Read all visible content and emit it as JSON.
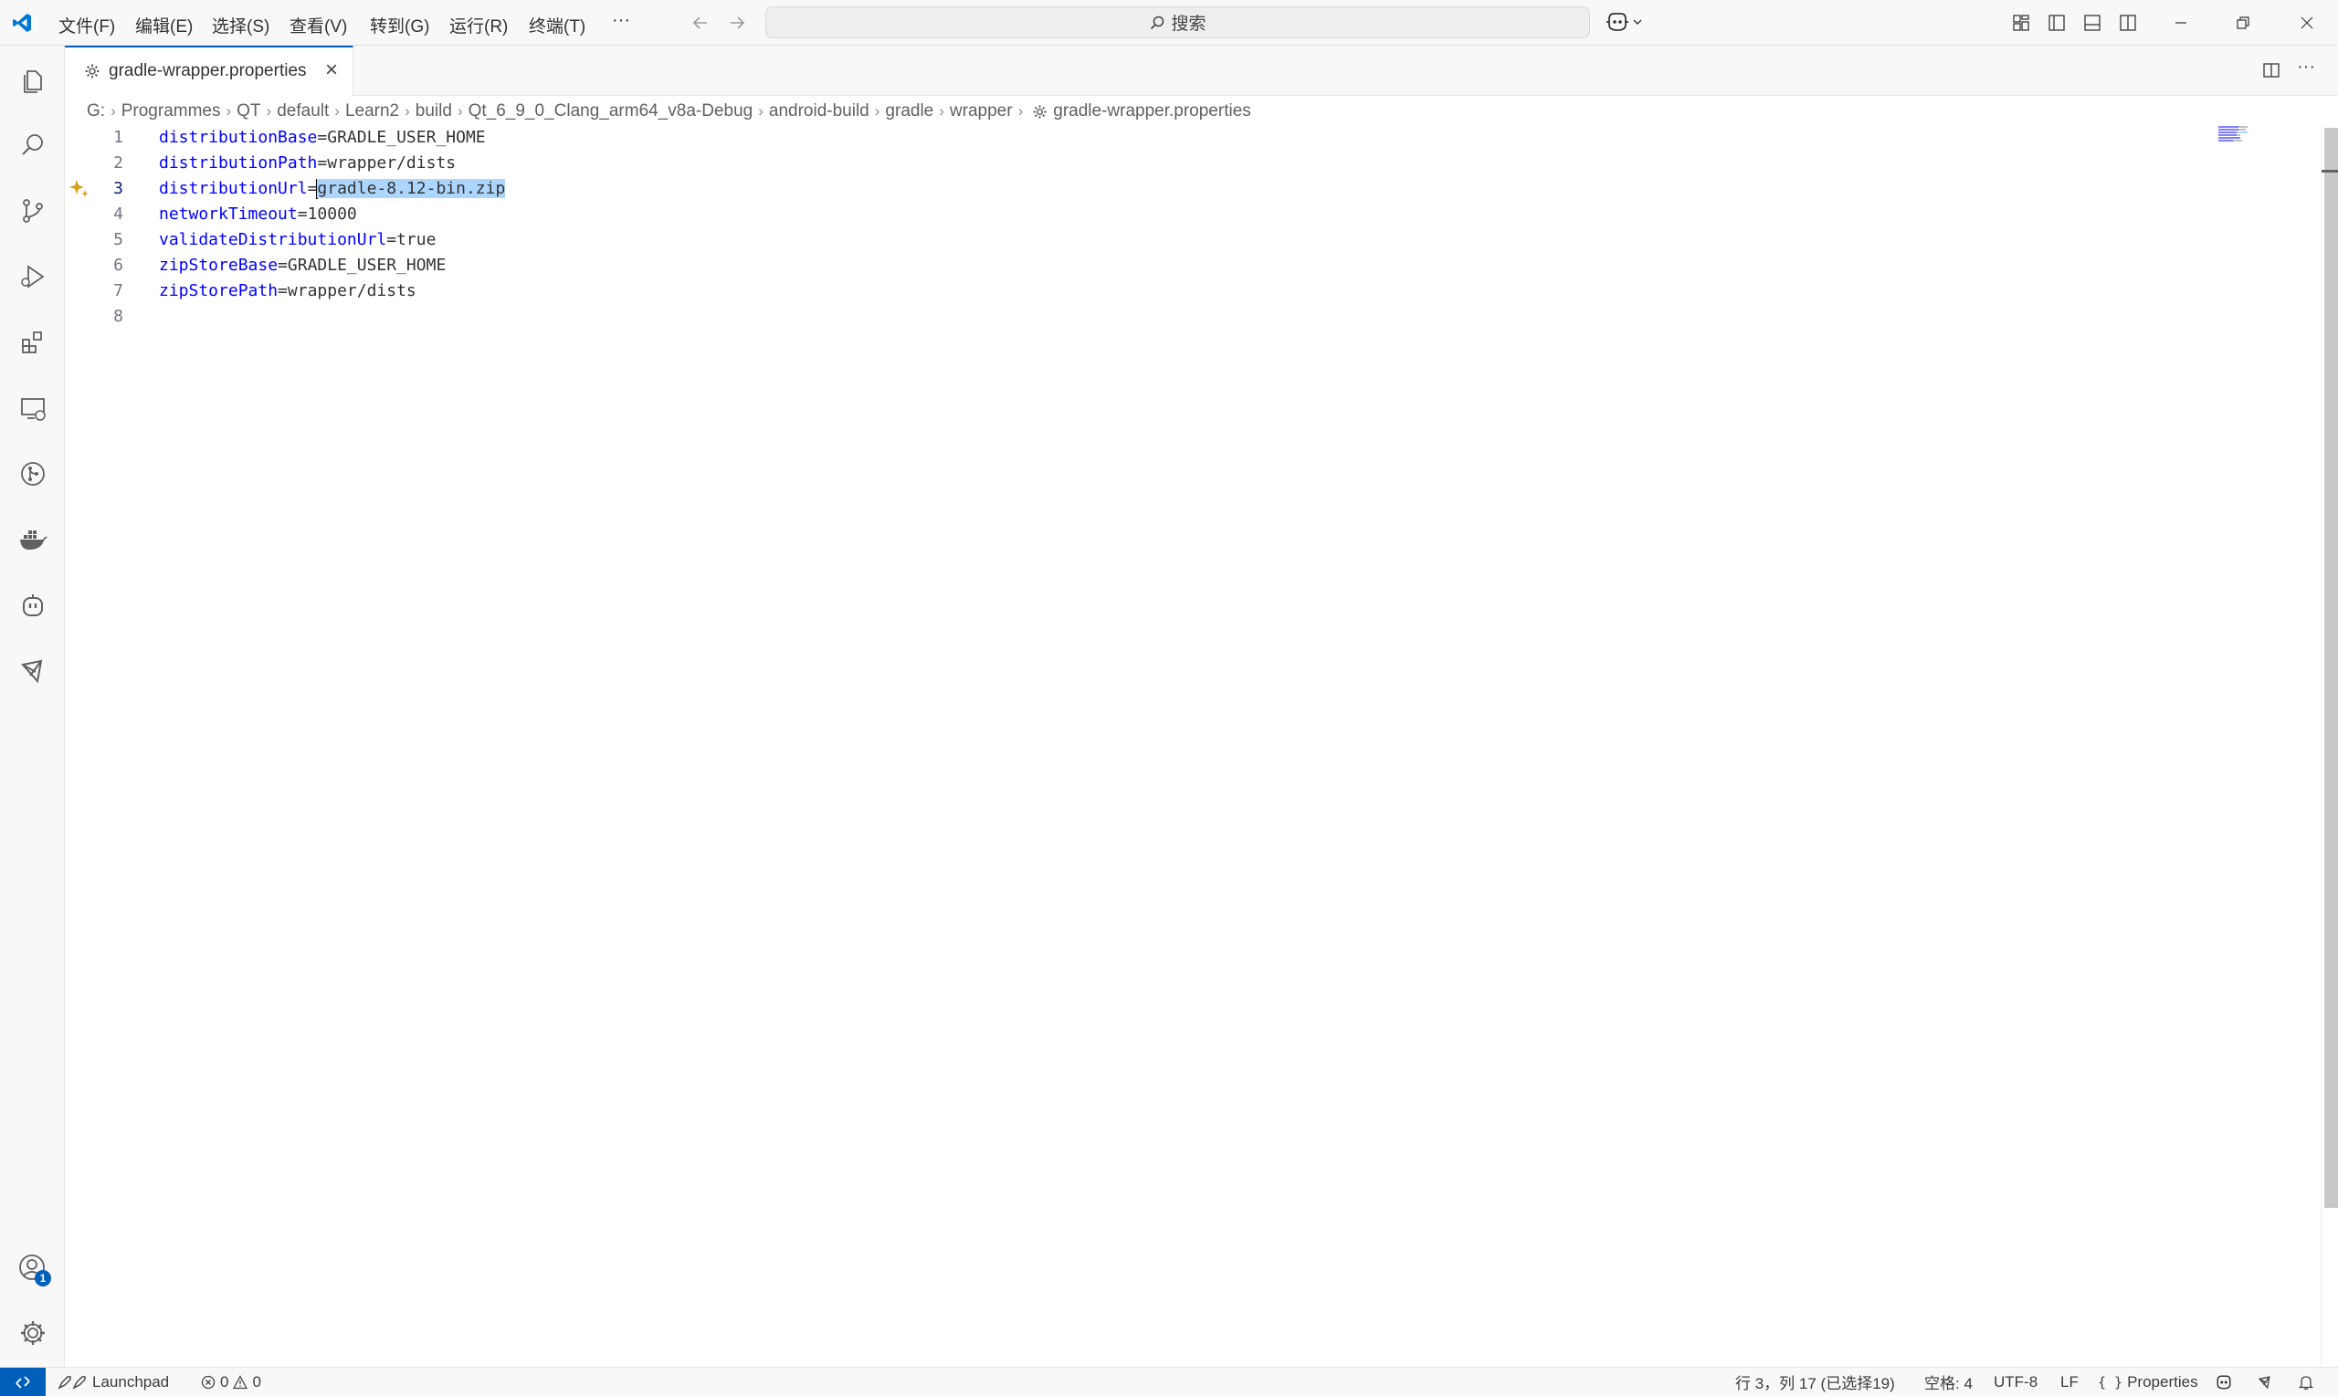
{
  "menu": {
    "items": [
      "文件(F)",
      "编辑(E)",
      "选择(S)",
      "查看(V)",
      "转到(G)",
      "运行(R)",
      "终端(T)"
    ],
    "more": "···"
  },
  "search": {
    "placeholder": "搜索"
  },
  "tab": {
    "title": "gradle-wrapper.properties",
    "close": "×"
  },
  "breadcrumb": [
    "G:",
    "Programmes",
    "QT",
    "default",
    "Learn2",
    "build",
    "Qt_6_9_0_Clang_arm64_v8a-Debug",
    "android-build",
    "gradle",
    "wrapper",
    "gradle-wrapper.properties"
  ],
  "editor": {
    "lines": [
      {
        "num": "1",
        "key": "distributionBase",
        "eq": "=",
        "value": "GRADLE_USER_HOME"
      },
      {
        "num": "2",
        "key": "distributionPath",
        "eq": "=",
        "value": "wrapper/dists"
      },
      {
        "num": "3",
        "key": "distributionUrl",
        "eq": "=",
        "value": "gradle-8.12-bin.zip"
      },
      {
        "num": "4",
        "key": "networkTimeout",
        "eq": "=",
        "value": "10000"
      },
      {
        "num": "5",
        "key": "validateDistributionUrl",
        "eq": "=",
        "value": "true"
      },
      {
        "num": "6",
        "key": "zipStoreBase",
        "eq": "=",
        "value": "GRADLE_USER_HOME"
      },
      {
        "num": "7",
        "key": "zipStorePath",
        "eq": "=",
        "value": "wrapper/dists"
      },
      {
        "num": "8",
        "key": "",
        "eq": "",
        "value": ""
      }
    ],
    "active_line": 3
  },
  "accounts_badge": "1",
  "statusbar": {
    "launchpad": "Launchpad",
    "errors": "0",
    "warnings": "0",
    "position": "行 3，列 17 (已选择19)",
    "spaces": "空格: 4",
    "encoding": "UTF-8",
    "eol": "LF",
    "language": "Properties"
  },
  "colors": {
    "accent": "#005fb8",
    "keyword": "#0000ff",
    "selection": "#add6ff",
    "sparkle": "#d4a017"
  }
}
